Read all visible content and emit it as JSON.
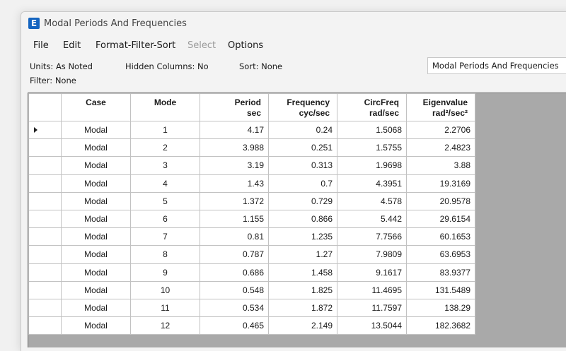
{
  "window": {
    "app_icon_letter": "E",
    "title": "Modal Periods And Frequencies"
  },
  "menu": [
    {
      "label": "File",
      "enabled": true
    },
    {
      "label": "Edit",
      "enabled": true
    },
    {
      "label": "Format-Filter-Sort",
      "enabled": true
    },
    {
      "label": "Select",
      "enabled": false
    },
    {
      "label": "Options",
      "enabled": true
    }
  ],
  "info": {
    "units_label": "Units:",
    "units_value": "As Noted",
    "hidden_label": "Hidden Columns:",
    "hidden_value": "No",
    "sort_label": "Sort:",
    "sort_value": "None",
    "filter_label": "Filter:",
    "filter_value": "None",
    "table_name": "Modal Periods And Frequencies"
  },
  "table": {
    "headers": [
      {
        "line1": "Case",
        "line2": ""
      },
      {
        "line1": "Mode",
        "line2": ""
      },
      {
        "line1": "Period",
        "line2": "sec"
      },
      {
        "line1": "Frequency",
        "line2": "cyc/sec"
      },
      {
        "line1": "CircFreq",
        "line2": "rad/sec"
      },
      {
        "line1": "Eigenvalue",
        "line2": "rad²/sec²"
      }
    ],
    "selected_row": 0,
    "rows": [
      [
        "Modal",
        "1",
        "4.17",
        "0.24",
        "1.5068",
        "2.2706"
      ],
      [
        "Modal",
        "2",
        "3.988",
        "0.251",
        "1.5755",
        "2.4823"
      ],
      [
        "Modal",
        "3",
        "3.19",
        "0.313",
        "1.9698",
        "3.88"
      ],
      [
        "Modal",
        "4",
        "1.43",
        "0.7",
        "4.3951",
        "19.3169"
      ],
      [
        "Modal",
        "5",
        "1.372",
        "0.729",
        "4.578",
        "20.9578"
      ],
      [
        "Modal",
        "6",
        "1.155",
        "0.866",
        "5.442",
        "29.6154"
      ],
      [
        "Modal",
        "7",
        "0.81",
        "1.235",
        "7.7566",
        "60.1653"
      ],
      [
        "Modal",
        "8",
        "0.787",
        "1.27",
        "7.9809",
        "63.6953"
      ],
      [
        "Modal",
        "9",
        "0.686",
        "1.458",
        "9.1617",
        "83.9377"
      ],
      [
        "Modal",
        "10",
        "0.548",
        "1.825",
        "11.4695",
        "131.5489"
      ],
      [
        "Modal",
        "11",
        "0.534",
        "1.872",
        "11.7597",
        "138.29"
      ],
      [
        "Modal",
        "12",
        "0.465",
        "2.149",
        "13.5044",
        "182.3682"
      ]
    ]
  }
}
